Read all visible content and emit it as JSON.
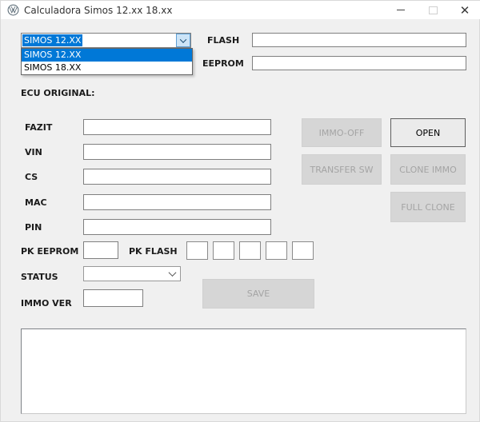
{
  "window": {
    "title": "Calculadora Simos 12.xx 18.xx"
  },
  "model_select": {
    "value": "SIMOS 12.XX",
    "options": [
      "SIMOS 12.XX",
      "SIMOS 18.XX"
    ],
    "selected_index": 0,
    "state": "open"
  },
  "sections": {
    "ecu_original": "ECU ORIGINAL:"
  },
  "fields": {
    "flash": {
      "label": "FLASH",
      "value": ""
    },
    "eeprom": {
      "label": "EEPROM",
      "value": ""
    },
    "fazit": {
      "label": "FAZIT",
      "value": ""
    },
    "vin": {
      "label": "VIN",
      "value": ""
    },
    "cs": {
      "label": "CS",
      "value": ""
    },
    "mac": {
      "label": "MAC",
      "value": ""
    },
    "pin": {
      "label": "PIN",
      "value": ""
    },
    "pk_eeprom": {
      "label": "PK EEPROM",
      "value": ""
    },
    "pk_flash": {
      "label": "PK FLASH",
      "values": [
        "",
        "",
        "",
        "",
        ""
      ]
    },
    "status": {
      "label": "STATUS",
      "value": ""
    },
    "immo_ver": {
      "label": "IMMO VER",
      "value": ""
    }
  },
  "buttons": {
    "immo_off": {
      "label": "IMMO-OFF",
      "enabled": false
    },
    "open": {
      "label": "OPEN",
      "enabled": true
    },
    "transfer_sw": {
      "label": "TRANSFER SW",
      "enabled": false
    },
    "clone_immo": {
      "label": "CLONE IMMO",
      "enabled": false
    },
    "full_clone": {
      "label": "FULL CLONE",
      "enabled": false
    },
    "save": {
      "label": "SAVE",
      "enabled": false
    }
  },
  "log": {
    "value": ""
  },
  "colors": {
    "accent": "#0078d7",
    "combo_button_bg": "#cce4f7",
    "window_bg": "#f0f0f0",
    "titlebar_bg": "#ffffff",
    "disabled_button_bg": "#d6d6d6",
    "disabled_button_text": "#a4a4a4"
  }
}
